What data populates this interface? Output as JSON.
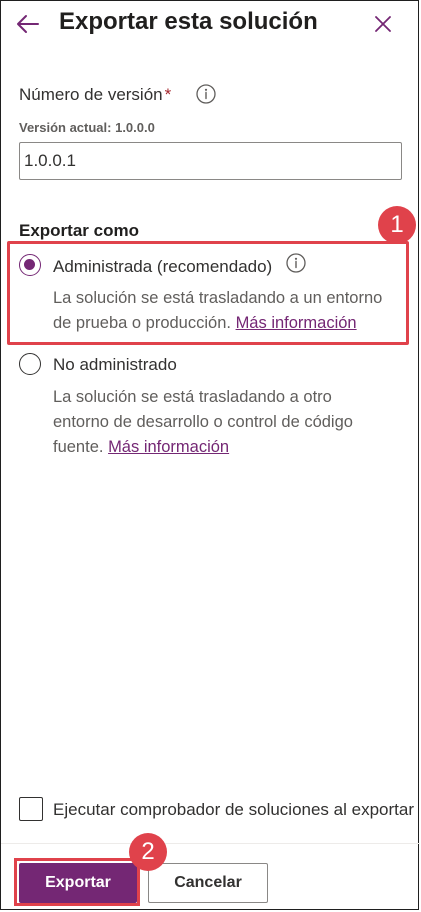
{
  "header": {
    "title": "Exportar esta solución",
    "back_icon": "arrow-left-icon",
    "close_icon": "close-icon"
  },
  "version": {
    "label": "Número de versión",
    "required_mark": "*",
    "current": "Versión actual: 1.0.0.0",
    "value": "1.0.0.1"
  },
  "export_as": {
    "label": "Exportar como",
    "options": [
      {
        "label": "Administrada (recomendado)",
        "selected": true,
        "desc": "La solución se está trasladando a un entorno de prueba o producción.",
        "link": "Más información"
      },
      {
        "label": "No administrado",
        "selected": false,
        "desc": "La solución se está trasladando a otro entorno de desarrollo o control de código fuente.",
        "link": "Más información"
      }
    ]
  },
  "checker": {
    "label": "Ejecutar comprobador de soluciones al exportar",
    "checked": false
  },
  "footer": {
    "export_label": "Exportar",
    "cancel_label": "Cancelar"
  },
  "annotations": {
    "badge_1": "1",
    "badge_2": "2"
  },
  "colors": {
    "accent": "#742774",
    "highlight": "#e0424b"
  }
}
